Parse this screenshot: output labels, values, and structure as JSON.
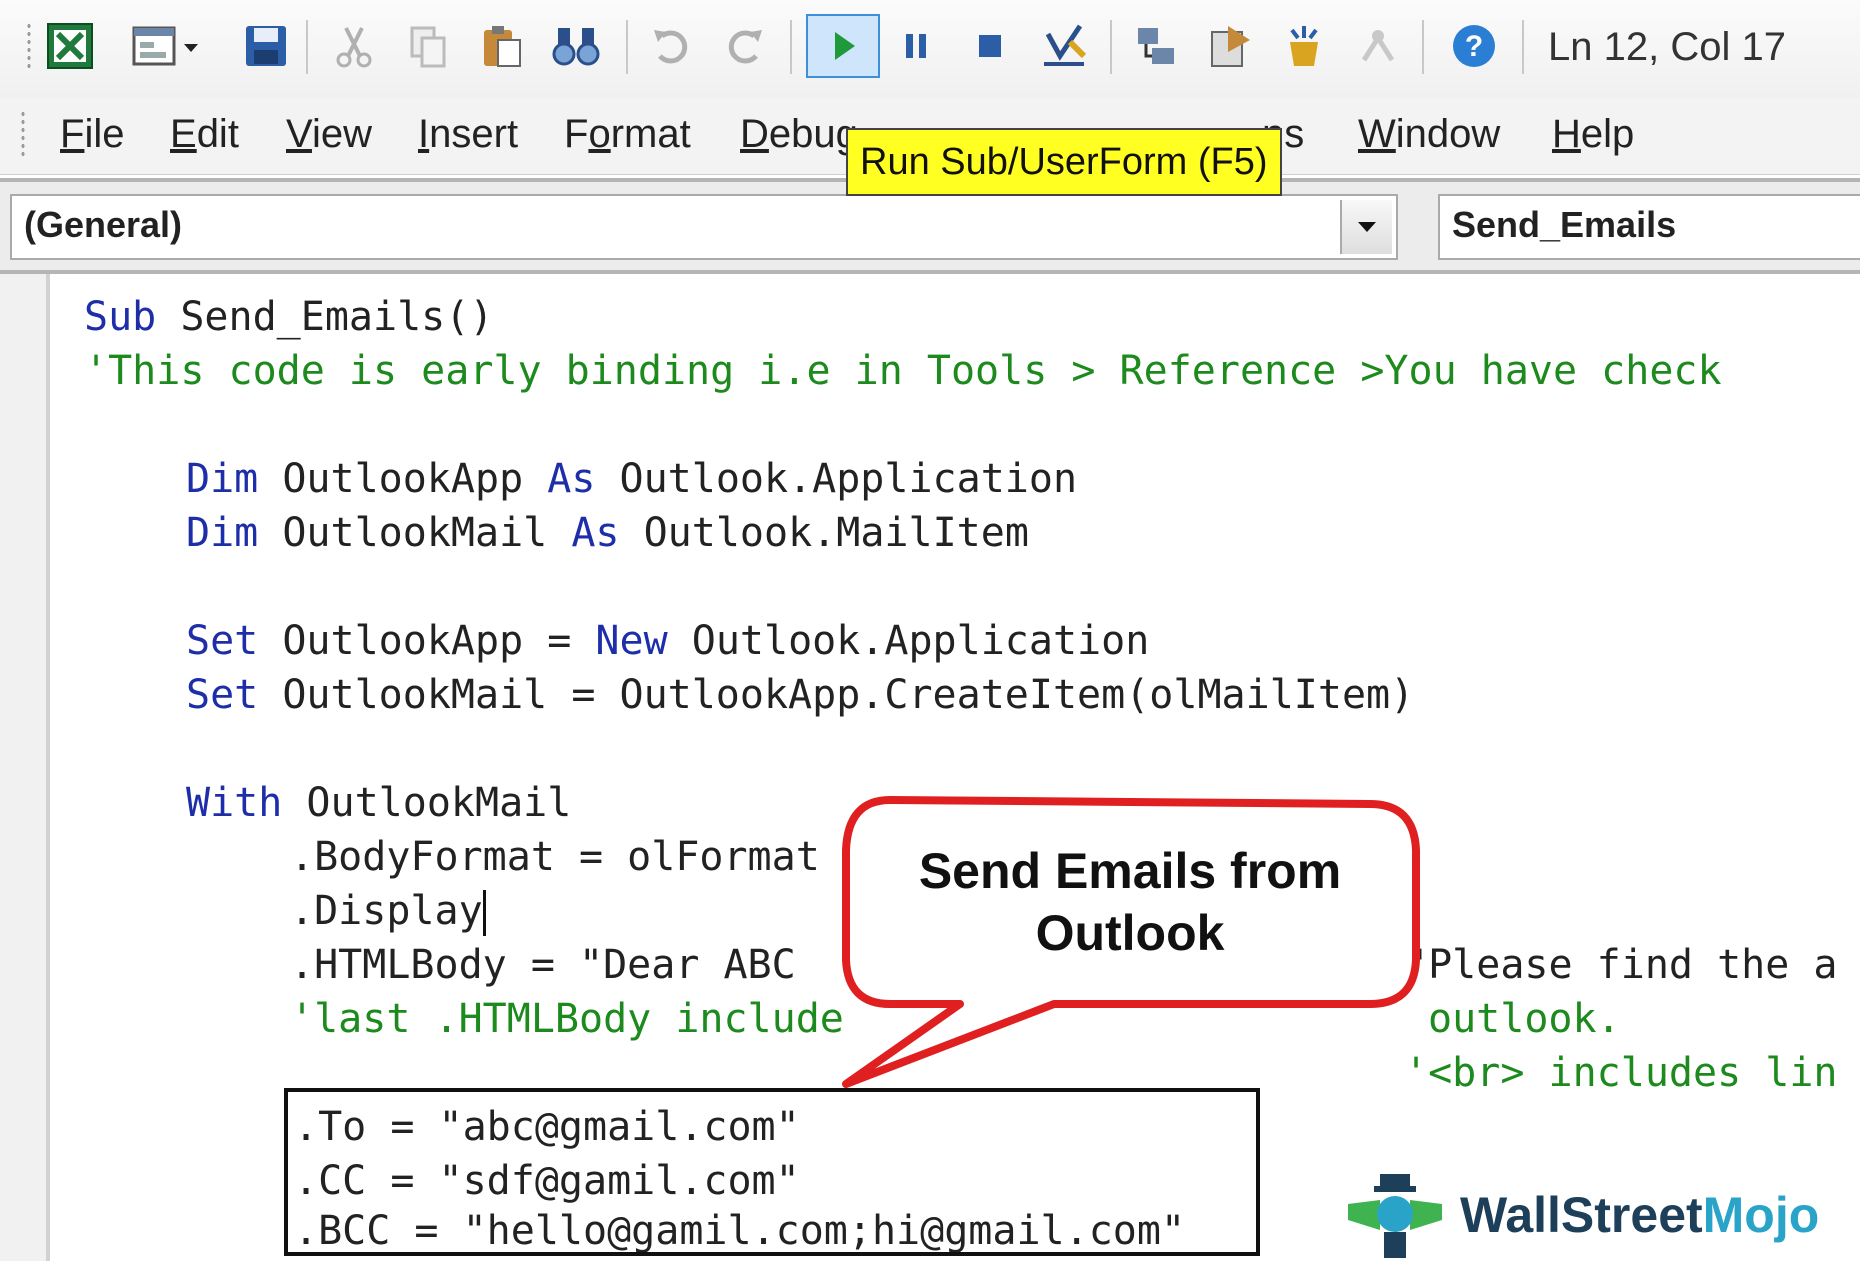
{
  "toolbar": {
    "icons": [
      "excel-icon",
      "insert-userform-icon",
      "dropdown-arrow-icon",
      "save-icon",
      "cut-icon",
      "copy-icon",
      "paste-icon",
      "find-icon",
      "undo-icon",
      "redo-icon",
      "run-icon",
      "break-icon",
      "reset-icon",
      "design-mode-icon",
      "project-explorer-icon",
      "properties-window-icon",
      "object-browser-icon",
      "toolbox-icon",
      "help-icon"
    ],
    "cursor_position": "Ln 12, Col 17"
  },
  "menu": {
    "items": [
      {
        "underline": "F",
        "rest": "ile"
      },
      {
        "underline": "E",
        "rest": "dit"
      },
      {
        "underline": "V",
        "rest": "iew"
      },
      {
        "underline": "I",
        "rest": "nsert"
      },
      {
        "pre": "F",
        "underline": "o",
        "rest": "rmat"
      },
      {
        "underline": "D",
        "rest": "ebug"
      },
      {
        "underline": "W",
        "rest": "indow"
      },
      {
        "underline": "H",
        "rest": "elp"
      }
    ],
    "partial_addins": "ns"
  },
  "tooltip": {
    "text": "Run Sub/UserForm (F5)"
  },
  "combos": {
    "object": "(General)",
    "procedure": "Send_Emails"
  },
  "code": {
    "line1_kw": "Sub",
    "line1_rest": " Send_Emails()",
    "line2": "'This code is early binding i.e in Tools > Reference >You have check",
    "line3_kw": "Dim",
    "line3_mid": " OutlookApp ",
    "line3_kw2": "As",
    "line3_rest": " Outlook.Application",
    "line4_kw": "Dim",
    "line4_mid": " OutlookMail ",
    "line4_kw2": "As",
    "line4_rest": " Outlook.MailItem",
    "line5_kw": "Set",
    "line5_mid": " OutlookApp = ",
    "line5_kw2": "New",
    "line5_rest": " Outlook.Application",
    "line6_kw": "Set",
    "line6_rest": " OutlookMail = OutlookApp.CreateItem(olMailItem)",
    "line7_kw": "With",
    "line7_rest": " OutlookMail",
    "line8": ".BodyFormat = olFormat",
    "line9": ".Display",
    "line10_left": ".HTMLBody = \"Dear ABC",
    "line10_right": "\"Please find the a",
    "line11_left": "'last .HTMLBody include",
    "line11_right": "outlook.",
    "line12": "'<br> includes lin",
    "line13": ".To = \"abc@gmail.com\"",
    "line14": ".CC = \"sdf@gamil.com\"",
    "line15": ".BCC = \"hello@gamil.com;hi@gmail.com\""
  },
  "callout": {
    "line1": "Send Emails from",
    "line2": "Outlook"
  },
  "logo": {
    "brand": "WallStreet",
    "accent": "Mojo"
  },
  "colors": {
    "keyword": "#1e2ea8",
    "comment": "#1c8a1c",
    "tooltip_bg": "#ffff22",
    "callout_border": "#e02020"
  }
}
